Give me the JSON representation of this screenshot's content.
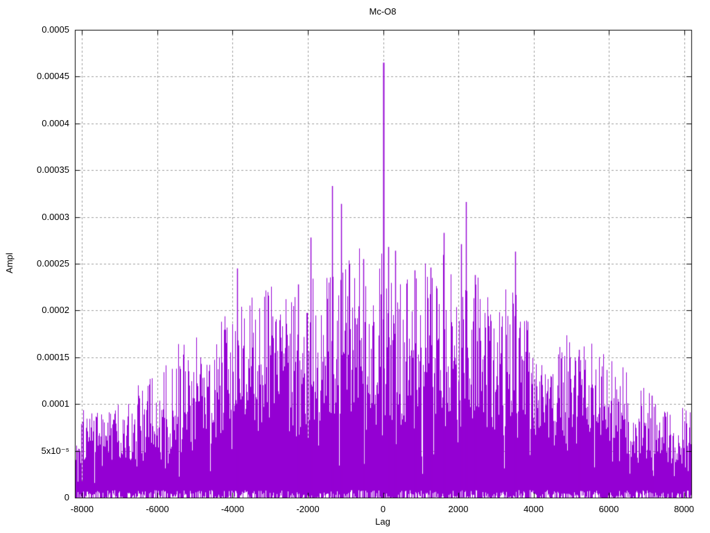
{
  "page": {
    "background": "#ffffff",
    "text_color": "#000000"
  },
  "chart_data": {
    "type": "bar",
    "subtype": "impulses-correlogram",
    "title": "Mc-O8",
    "xlabel": "Lag",
    "ylabel": "Ampl",
    "xlim": [
      -8192,
      8192
    ],
    "ylim": [
      0,
      0.0005
    ],
    "grid": true,
    "legend": "none",
    "series_color": "#9400d3",
    "grid_color": "#9c9c9c",
    "frame_color": "#000000",
    "xticks": [
      {
        "value": -8000,
        "label": "-8000"
      },
      {
        "value": -6000,
        "label": "-6000"
      },
      {
        "value": -4000,
        "label": "-4000"
      },
      {
        "value": -2000,
        "label": "-2000"
      },
      {
        "value": 0,
        "label": "0"
      },
      {
        "value": 2000,
        "label": "2000"
      },
      {
        "value": 4000,
        "label": "4000"
      },
      {
        "value": 6000,
        "label": "6000"
      },
      {
        "value": 8000,
        "label": "8000"
      }
    ],
    "yticks": [
      {
        "value": 0,
        "label": "0"
      },
      {
        "value": 5e-05,
        "label": "5x10⁻⁵"
      },
      {
        "value": 0.0001,
        "label": "0.0001"
      },
      {
        "value": 0.00015,
        "label": "0.00015"
      },
      {
        "value": 0.0002,
        "label": "0.0002"
      },
      {
        "value": 0.00025,
        "label": "0.00025"
      },
      {
        "value": 0.0003,
        "label": "0.0003"
      },
      {
        "value": 0.00035,
        "label": "0.00035"
      },
      {
        "value": 0.0004,
        "label": "0.0004"
      },
      {
        "value": 0.00045,
        "label": "0.00045"
      },
      {
        "value": 0.0005,
        "label": "0.0005"
      }
    ],
    "noise_envelope": [
      [
        -8192,
        8.2e-05
      ],
      [
        -7800,
        9.2e-05
      ],
      [
        -7400,
        0.0001
      ],
      [
        -7000,
        0.000108
      ],
      [
        -6600,
        0.000115
      ],
      [
        -6200,
        0.000128
      ],
      [
        -5800,
        0.00014
      ],
      [
        -5400,
        0.00015
      ],
      [
        -5000,
        0.000162
      ],
      [
        -4600,
        0.000175
      ],
      [
        -4200,
        0.000182
      ],
      [
        -3800,
        0.0002
      ],
      [
        -3400,
        0.000212
      ],
      [
        -3000,
        0.000218
      ],
      [
        -2600,
        0.000222
      ],
      [
        -2200,
        0.000228
      ],
      [
        -1800,
        0.000235
      ],
      [
        -1400,
        0.000245
      ],
      [
        -1000,
        0.00025
      ],
      [
        -600,
        0.000242
      ],
      [
        -200,
        0.000248
      ],
      [
        0,
        0.000255
      ],
      [
        200,
        0.00025
      ],
      [
        600,
        0.000238
      ],
      [
        1000,
        0.000232
      ],
      [
        1400,
        0.000242
      ],
      [
        1800,
        0.00025
      ],
      [
        2200,
        0.000248
      ],
      [
        2600,
        0.000222
      ],
      [
        3000,
        0.00021
      ],
      [
        3400,
        0.000225
      ],
      [
        3800,
        0.0002
      ],
      [
        4200,
        0.000175
      ],
      [
        4600,
        0.000168
      ],
      [
        5000,
        0.00017
      ],
      [
        5400,
        0.000158
      ],
      [
        5800,
        0.000145
      ],
      [
        6200,
        0.000132
      ],
      [
        6600,
        0.00012
      ],
      [
        7000,
        0.00011
      ],
      [
        7400,
        0.000102
      ],
      [
        7800,
        9.3e-05
      ],
      [
        8192,
        8.6e-05
      ]
    ],
    "peaks": [
      {
        "lag": 0,
        "ampl": 0.000465
      },
      {
        "lag": -1361,
        "ampl": 0.000333
      },
      {
        "lag": 2205,
        "ampl": 0.000316
      },
      {
        "lag": -1107,
        "ampl": 0.000314
      },
      {
        "lag": 1620,
        "ampl": 0.000283
      },
      {
        "lag": -1930,
        "ampl": 0.000278
      },
      {
        "lag": 2080,
        "ampl": 0.000271
      },
      {
        "lag": 130,
        "ampl": 0.000268
      },
      {
        "lag": 330,
        "ampl": 0.000264
      },
      {
        "lag": 3515,
        "ampl": 0.000263
      },
      {
        "lag": -530,
        "ampl": 0.000255
      },
      {
        "lag": 1270,
        "ampl": 0.000246
      },
      {
        "lag": -3880,
        "ampl": 0.000245
      },
      {
        "lag": 830,
        "ampl": 0.000243
      },
      {
        "lag": 2450,
        "ampl": 0.000238
      },
      {
        "lag": -2260,
        "ampl": 0.000228
      },
      {
        "lag": 5200,
        "ampl": 0.000158
      },
      {
        "lag": 7150,
        "ampl": 0.000109
      }
    ]
  }
}
